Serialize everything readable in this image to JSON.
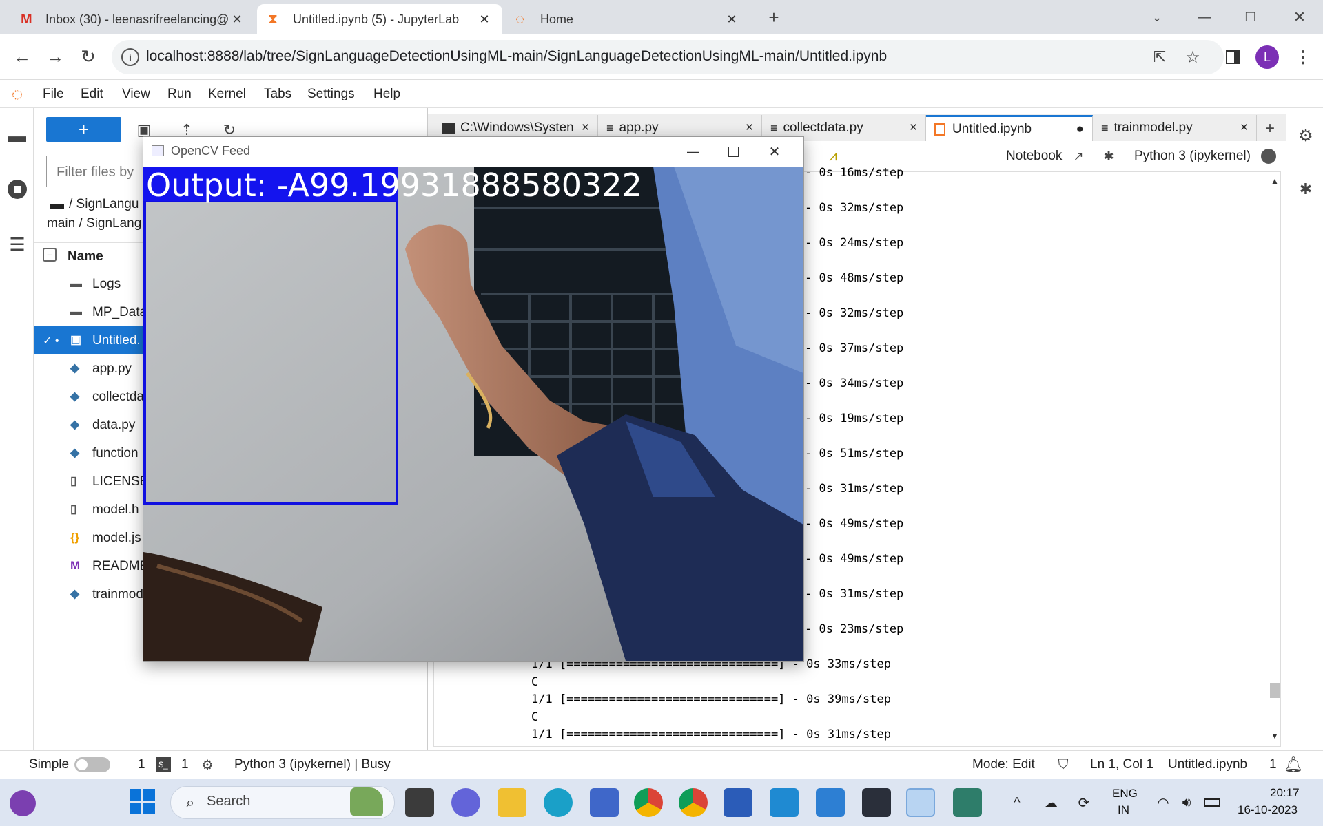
{
  "browser": {
    "tabs": [
      {
        "title": "Inbox (30) - leenasrifreelancing@",
        "icon": "gmail-icon"
      },
      {
        "title": "Untitled.ipynb (5) - JupyterLab",
        "icon": "jupyter-hourglass-icon",
        "active": true
      },
      {
        "title": "Home",
        "icon": "jupyter-icon"
      }
    ],
    "url": "localhost:8888/lab/tree/SignLanguageDetectionUsingML-main/SignLanguageDetectionUsingML-main/Untitled.ipynb",
    "profile_initial": "L",
    "accent": "#7b2fb5"
  },
  "menu": [
    "File",
    "Edit",
    "View",
    "Run",
    "Kernel",
    "Tabs",
    "Settings",
    "Help"
  ],
  "filebrowser": {
    "new_label": "+",
    "filter_placeholder": "Filter files by",
    "breadcrumb_line1": "/ SignLangu",
    "breadcrumb_line2": "main / SignLang",
    "column_name": "Name",
    "files": [
      {
        "name": "Logs",
        "type": "folder"
      },
      {
        "name": "MP_Data",
        "type": "folder"
      },
      {
        "name": "Untitled.",
        "type": "notebook",
        "selected": true
      },
      {
        "name": "app.py",
        "type": "python"
      },
      {
        "name": "collectda",
        "type": "python"
      },
      {
        "name": "data.py",
        "type": "python"
      },
      {
        "name": "function",
        "type": "python"
      },
      {
        "name": "LICENSE",
        "type": "file"
      },
      {
        "name": "model.h",
        "type": "file"
      },
      {
        "name": "model.js",
        "type": "json"
      },
      {
        "name": "README",
        "type": "markdown"
      },
      {
        "name": "trainmod",
        "type": "python"
      }
    ]
  },
  "notebook": {
    "tabs": [
      {
        "label": "C:\\Windows\\Systen",
        "close": "×"
      },
      {
        "label": "app.py",
        "close": "×"
      },
      {
        "label": "collectdata.py",
        "close": "×"
      },
      {
        "label": "Untitled.ipynb",
        "close": "●",
        "active": true
      },
      {
        "label": "trainmodel.py",
        "close": "×"
      }
    ],
    "toolbar": {
      "mode_label": "Notebook",
      "kernel": "Python 3 (ipykernel)"
    },
    "output_lines": [
      "- 0s 16ms/step",
      "- 0s 32ms/step",
      "- 0s 24ms/step",
      "- 0s 48ms/step",
      "- 0s 32ms/step",
      "- 0s 37ms/step",
      "- 0s 34ms/step",
      "- 0s 19ms/step",
      "- 0s 51ms/step",
      "- 0s 31ms/step",
      "- 0s 49ms/step",
      "- 0s 49ms/step",
      "- 0s 31ms/step",
      "- 0s 23ms/step",
      "1/1 [==============================] - 0s 33ms/step",
      "C",
      "1/1 [==============================] - 0s 39ms/step",
      "C",
      "1/1 [==============================] - 0s 31ms/step"
    ]
  },
  "opencv": {
    "title": "OpenCV Feed",
    "output_text": "Output: -A99.19931888580322"
  },
  "status": {
    "mode": "Simple",
    "count1": "1",
    "count2": "1",
    "kernel_status": "Python 3 (ipykernel) | Busy",
    "edit_mode": "Mode: Edit",
    "position": "Ln 1, Col 1",
    "filename": "Untitled.ipynb",
    "notifications": "1"
  },
  "taskbar": {
    "search_label": "Search",
    "lang_line1": "ENG",
    "lang_line2": "IN",
    "time": "20:17",
    "date": "16-10-2023"
  }
}
